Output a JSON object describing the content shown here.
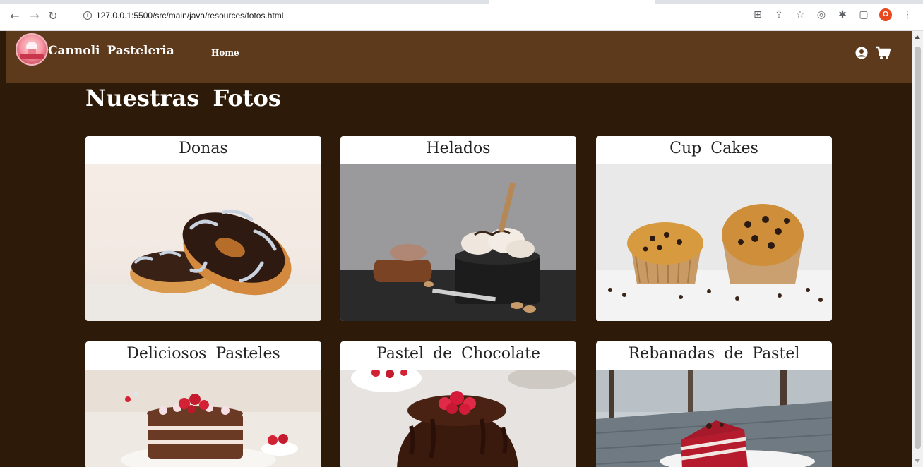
{
  "browser": {
    "url": "127.0.0.1:5500/src/main/java/resources/fotos.html",
    "profile_initial": "O"
  },
  "navbar": {
    "brand": "Cannoli Pasteleria",
    "home_link": "Home"
  },
  "page": {
    "title": "Nuestras Fotos"
  },
  "gallery": [
    {
      "title": "Donas"
    },
    {
      "title": "Helados"
    },
    {
      "title": "Cup Cakes"
    },
    {
      "title": "Deliciosos Pasteles"
    },
    {
      "title": "Pastel de Chocolate"
    },
    {
      "title": "Rebanadas de Pastel"
    }
  ],
  "colors": {
    "page_bg": "#2e1a08",
    "navbar_bg": "#5e3a1c",
    "card_bg": "#ffffff"
  }
}
